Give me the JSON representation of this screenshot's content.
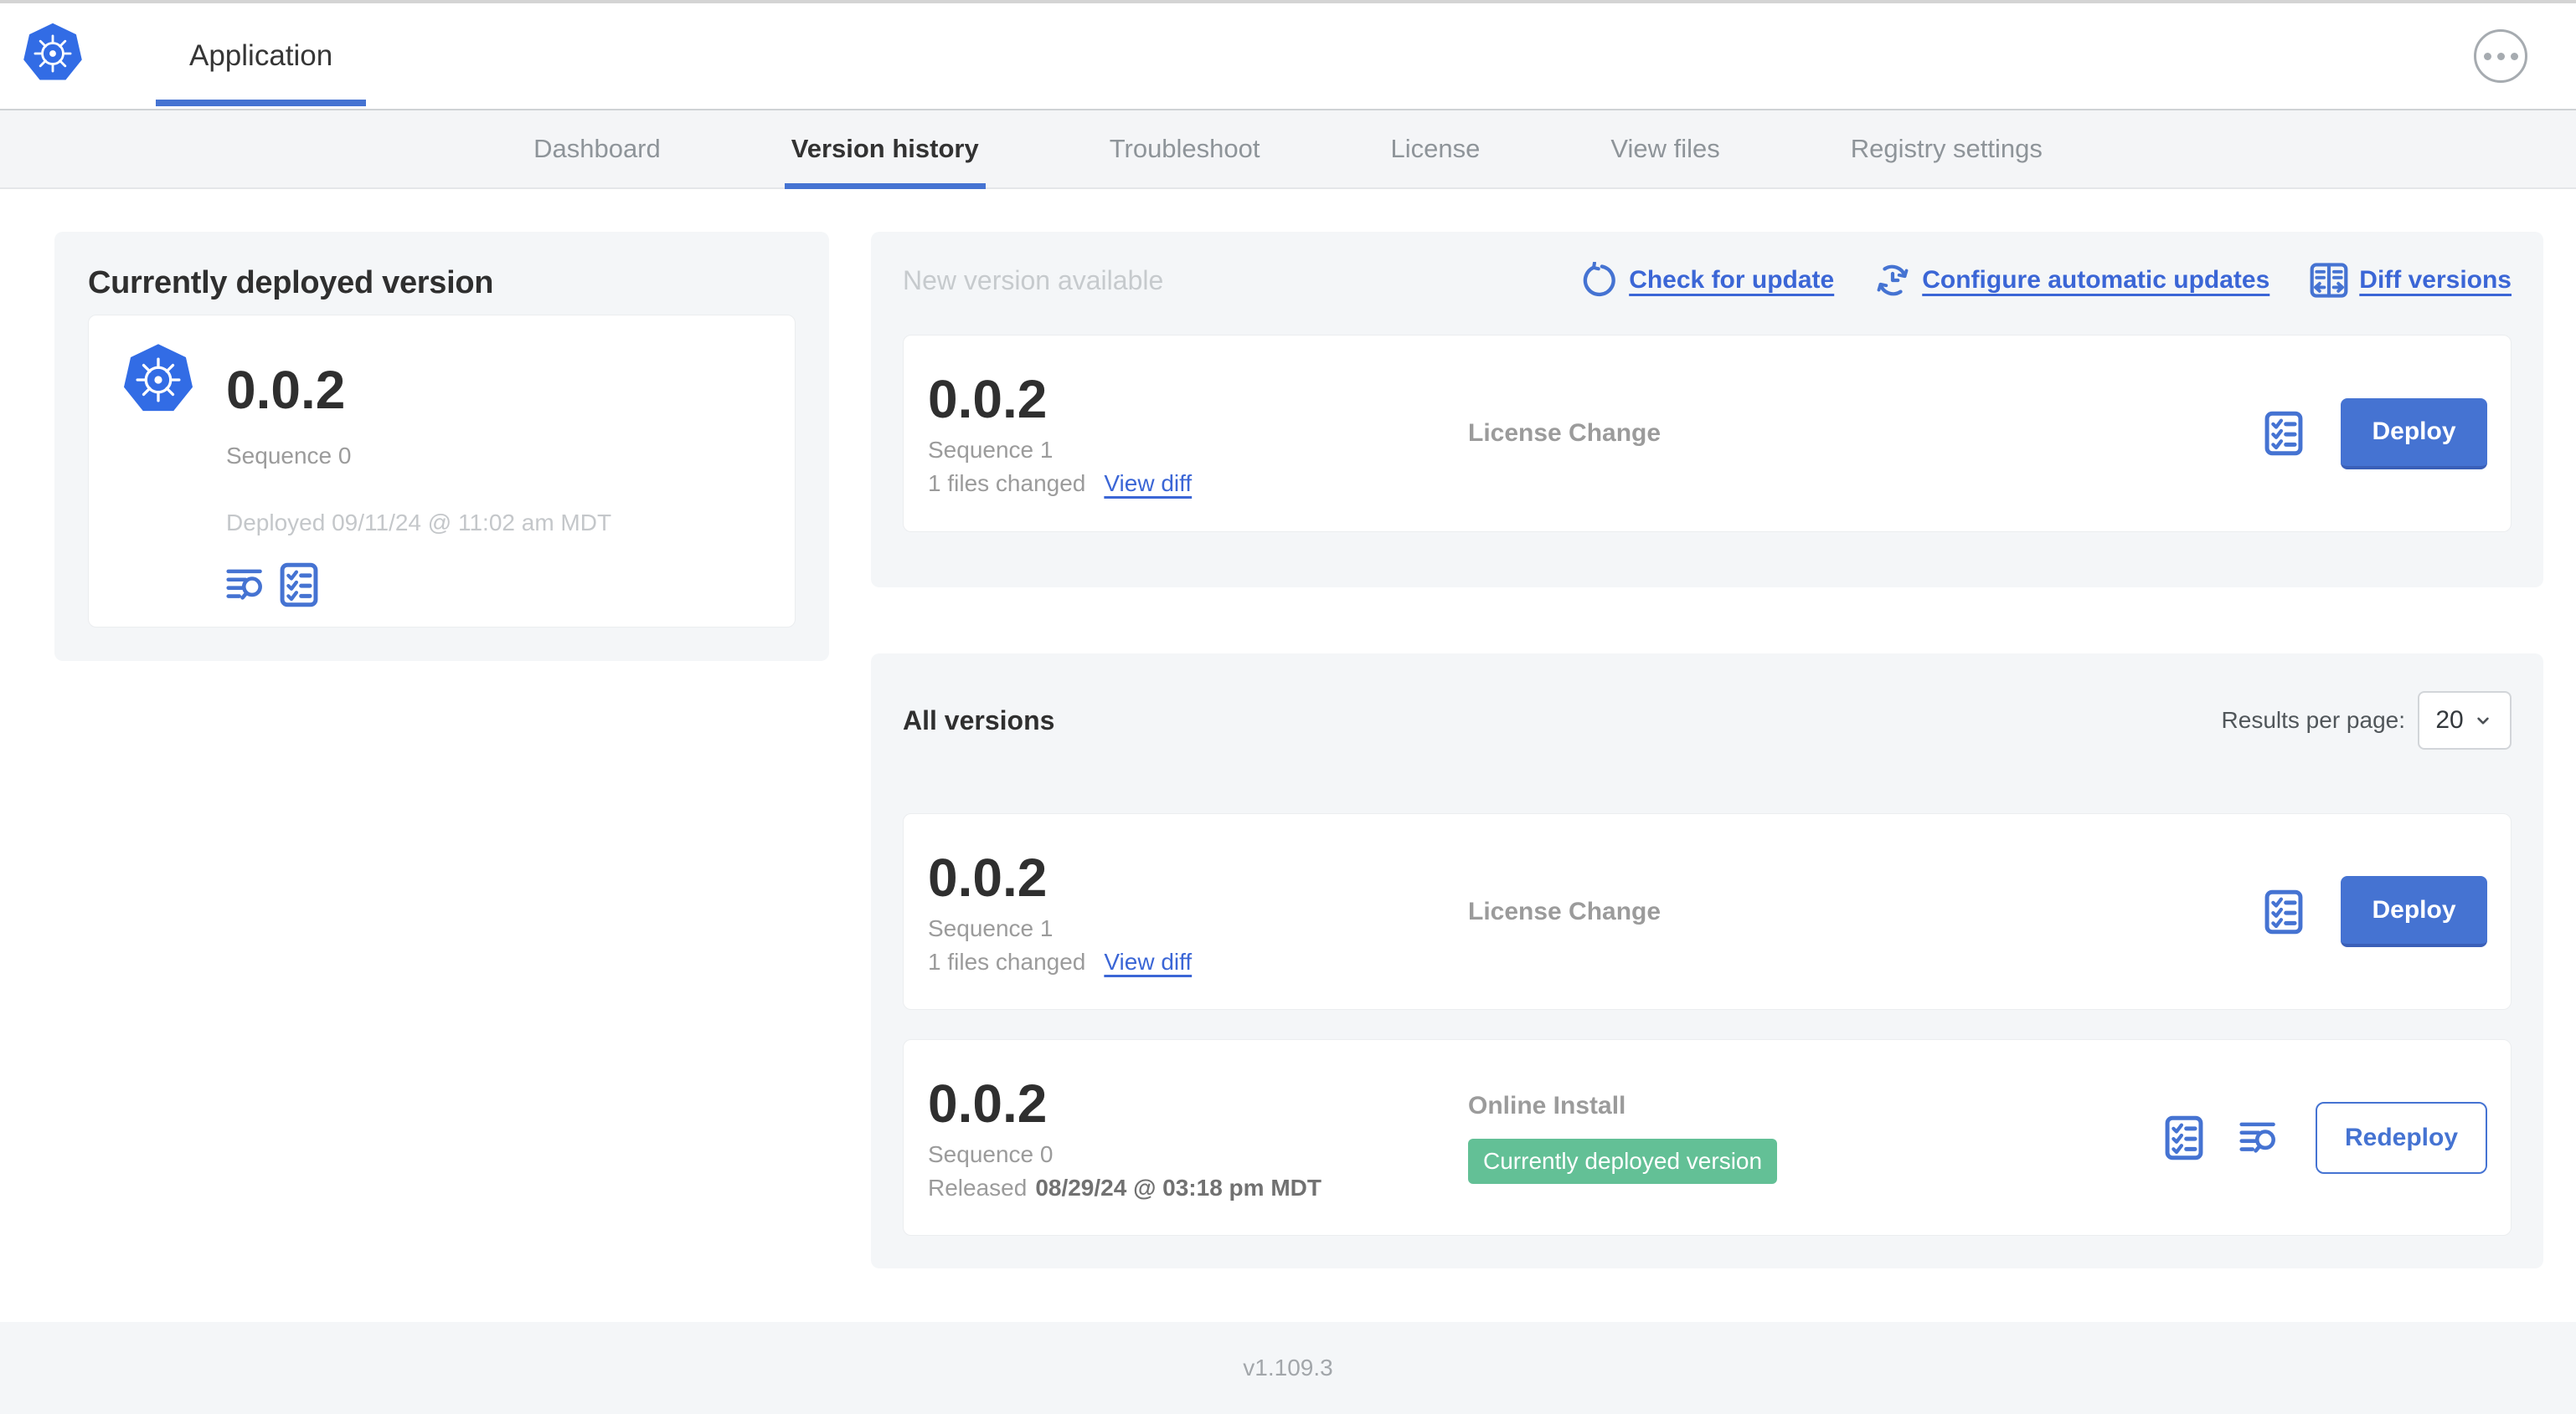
{
  "header": {
    "app_tab_label": "Application"
  },
  "nav": {
    "tabs": [
      {
        "label": "Dashboard",
        "active": false
      },
      {
        "label": "Version history",
        "active": true
      },
      {
        "label": "Troubleshoot",
        "active": false
      },
      {
        "label": "License",
        "active": false
      },
      {
        "label": "View files",
        "active": false
      },
      {
        "label": "Registry settings",
        "active": false
      }
    ]
  },
  "deployed": {
    "title": "Currently deployed version",
    "version": "0.0.2",
    "sequence": "Sequence 0",
    "deployed_at": "Deployed 09/11/24 @ 11:02 am MDT",
    "icons": [
      "view-logs-icon",
      "preflight-checks-icon"
    ]
  },
  "new_version": {
    "title": "New version available",
    "actions": [
      {
        "label": "Check for update",
        "icon": "refresh-icon"
      },
      {
        "label": "Configure automatic updates",
        "icon": "auto-update-schedule-icon"
      },
      {
        "label": "Diff versions",
        "icon": "diff-icon"
      }
    ],
    "card": {
      "version": "0.0.2",
      "sequence": "Sequence 1",
      "files_changed": "1 files changed",
      "view_diff_label": "View diff",
      "source": "License Change",
      "action_label": "Deploy"
    }
  },
  "all_versions": {
    "title": "All versions",
    "results_per_page_label": "Results per page:",
    "results_per_page_value": "20",
    "rows": [
      {
        "version": "0.0.2",
        "sequence": "Sequence 1",
        "files_changed": "1 files changed",
        "view_diff_label": "View diff",
        "source": "License Change",
        "action_label": "Deploy"
      },
      {
        "version": "0.0.2",
        "sequence": "Sequence 0",
        "released_prefix": "Released",
        "released_date": "08/29/24 @ 03:18 pm MDT",
        "source": "Online Install",
        "badge": "Currently deployed version",
        "action_label": "Redeploy"
      }
    ]
  },
  "footer": {
    "version_label": "v1.109.3"
  },
  "colors": {
    "accent_blue": "#4573d2",
    "link_blue": "#3b66d6",
    "kubernetes_blue": "#326ce5",
    "badge_green": "#63c096",
    "panel_gray": "#f4f6f8",
    "text_dark": "#323232",
    "text_gray": "#9b9b9b",
    "text_light_gray": "#c4c7ca"
  }
}
